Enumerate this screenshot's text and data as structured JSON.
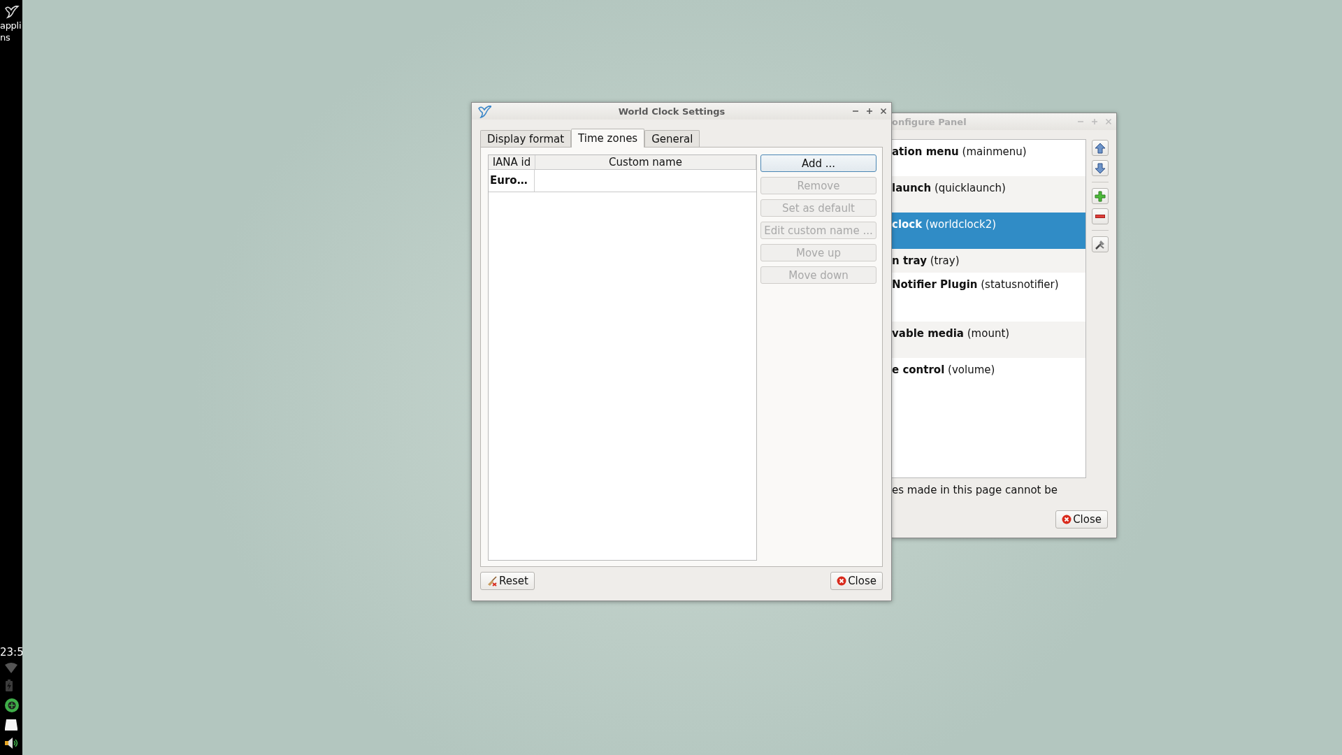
{
  "side_panel": {
    "menu_label_lines": [
      "appli",
      "ns"
    ],
    "clock": "23:5"
  },
  "panel_config_window": {
    "title": "onfigure Panel",
    "plugins": [
      {
        "label": "**ation menu** (mainmenu)",
        "selected": false
      },
      {
        "label": "**launch** (quicklaunch)",
        "selected": false
      },
      {
        "label": "**clock** (worldclock2)",
        "selected": true
      },
      {
        "label": "**n tray** (tray)",
        "selected": false
      },
      {
        "label": "**Notifier Plugin** (statusnotifier)",
        "selected": false
      },
      {
        "label": "**vable media** (mount)",
        "selected": false
      },
      {
        "label": "**e control** (volume)",
        "selected": false
      }
    ],
    "note": "es made in this page cannot be",
    "close_button": "Close"
  },
  "dialog": {
    "title": "World Clock Settings",
    "tabs": [
      {
        "label": "Display format",
        "selected": false
      },
      {
        "label": "Time zones",
        "selected": true
      },
      {
        "label": "General",
        "selected": false
      }
    ],
    "table": {
      "columns": [
        "IANA id",
        "Custom name"
      ],
      "rows": [
        {
          "iana_id": "Euro…"
        }
      ]
    },
    "buttons": [
      {
        "label": "Add ...",
        "disabled": false,
        "default": true
      },
      {
        "label": "Remove",
        "disabled": true,
        "default": false
      },
      {
        "label": "Set as default",
        "disabled": true,
        "default": false
      },
      {
        "label": "Edit custom name ...",
        "disabled": true,
        "default": false
      },
      {
        "label": "Move up",
        "disabled": true,
        "default": false
      },
      {
        "label": "Move down",
        "disabled": true,
        "default": false
      }
    ],
    "reset_button": "Reset",
    "close_button": "Close"
  }
}
